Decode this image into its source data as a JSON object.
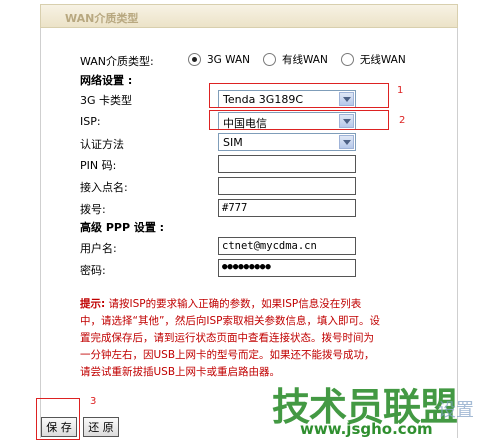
{
  "header": {
    "title": "WAN介质类型"
  },
  "wan_type": {
    "label": "WAN介质类型:",
    "options": [
      {
        "label": "3G WAN",
        "selected": true
      },
      {
        "label": "有线WAN",
        "selected": false
      },
      {
        "label": "无线WAN",
        "selected": false
      }
    ]
  },
  "network": {
    "section_title": "网络设置 :",
    "card_type": {
      "label": "3G 卡类型",
      "value": "Tenda 3G189C"
    },
    "isp": {
      "label": "ISP:",
      "value": "中国电信"
    },
    "auth": {
      "label": "认证方法",
      "value": "SIM"
    },
    "pin": {
      "label": "PIN 码:",
      "value": ""
    },
    "apn": {
      "label": "接入点名:",
      "value": ""
    },
    "dial": {
      "label": "拨号:",
      "value": "#777"
    }
  },
  "ppp": {
    "section_title": "高级 PPP 设置 :",
    "username": {
      "label": "用户名:",
      "value": "ctnet@mycdma.cn"
    },
    "password": {
      "label": "密码:",
      "value": "●●●●●●●●●"
    }
  },
  "hint": {
    "prefix": "提示:",
    "text": "请按ISP的要求输入正确的参数，如果ISP信息没在列表中，请选择“其他”，然后向ISP索取相关参数信息，填入即可。设置完成保存后，请到运行状态页面中查看连接状态。拨号时间为一分钟左右，因USB上网卡的型号而定。如果还不能拨号成功，请尝试重新拔插USB上网卡或重启路由器。"
  },
  "annotations": {
    "n1": "1",
    "n2": "2",
    "n3": "3"
  },
  "buttons": {
    "save": "保 存",
    "restore": "还 原"
  },
  "watermark": {
    "brand": "技术员联盟",
    "url": "www.jsgho.com",
    "overlay": "设置"
  },
  "colors": {
    "annotation_red": "#dd2222",
    "hint_red": "#c00000",
    "watermark_green": "#2f8f2f"
  }
}
